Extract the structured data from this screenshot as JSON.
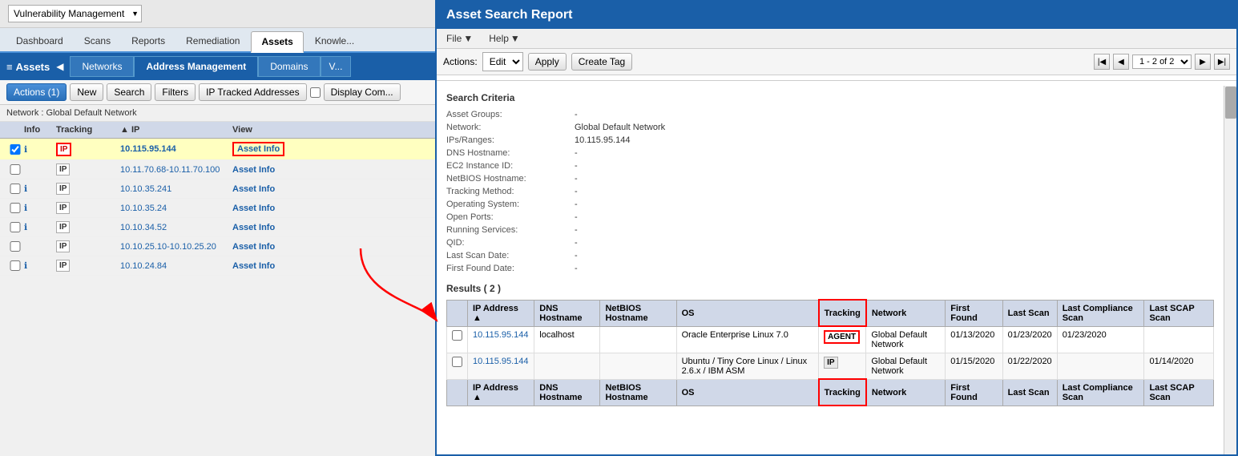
{
  "leftPanel": {
    "moduleSelect": "Vulnerability Management",
    "navTabs": [
      {
        "label": "Dashboard",
        "active": false
      },
      {
        "label": "Scans",
        "active": false
      },
      {
        "label": "Reports",
        "active": false
      },
      {
        "label": "Remediation",
        "active": false
      },
      {
        "label": "Assets",
        "active": true
      },
      {
        "label": "Knowle...",
        "active": false
      }
    ],
    "assetsTitle": "Assets",
    "subTabs": [
      {
        "label": "Networks",
        "active": false
      },
      {
        "label": "Address Management",
        "active": true
      },
      {
        "label": "Domains",
        "active": false
      },
      {
        "label": "V...",
        "active": false
      }
    ],
    "toolbar": {
      "actionsLabel": "Actions (1)",
      "newLabel": "New",
      "searchLabel": "Search",
      "filtersLabel": "Filters",
      "ipTrackedLabel": "IP Tracked Addresses",
      "displayCompLabel": "Display Com..."
    },
    "networkBar": "Network : Global Default Network",
    "tableColumns": [
      "",
      "Info",
      "Tracking",
      "IP",
      "View"
    ],
    "tableRows": [
      {
        "checked": true,
        "info": "i",
        "tracking": "IP",
        "ip": "10.115.95.144",
        "view": "Asset Info",
        "selected": true,
        "trackingHighlighted": true,
        "viewHighlighted": true
      },
      {
        "checked": false,
        "info": "",
        "tracking": "IP",
        "ip": "10.11.70.68-10.11.70.100",
        "view": "Asset Info",
        "selected": false
      },
      {
        "checked": false,
        "info": "i",
        "tracking": "IP",
        "ip": "10.10.35.241",
        "view": "Asset Info",
        "selected": false
      },
      {
        "checked": false,
        "info": "i",
        "tracking": "IP",
        "ip": "10.10.35.24",
        "view": "Asset Info",
        "selected": false
      },
      {
        "checked": false,
        "info": "i",
        "tracking": "IP",
        "ip": "10.10.34.52",
        "view": "Asset Info",
        "selected": false
      },
      {
        "checked": false,
        "info": "",
        "tracking": "IP",
        "ip": "10.10.25.10-10.10.25.20",
        "view": "Asset Info",
        "selected": false
      },
      {
        "checked": false,
        "info": "i",
        "tracking": "IP",
        "ip": "10.10.24.84",
        "view": "Asset Info",
        "selected": false
      }
    ]
  },
  "rightPanel": {
    "title": "Asset Search Report",
    "menu": {
      "file": "File",
      "help": "Help"
    },
    "toolbar": {
      "actionsLabel": "Actions:",
      "actionsValue": "Edit",
      "applyLabel": "Apply",
      "createTagLabel": "Create Tag"
    },
    "pagination": {
      "pageInfo": "1 - 2 of 2"
    },
    "searchCriteria": {
      "title": "Search Criteria",
      "rows": [
        {
          "label": "Asset Groups:",
          "value": "-"
        },
        {
          "label": "Network:",
          "value": "Global Default Network"
        },
        {
          "label": "IPs/Ranges:",
          "value": "10.115.95.144"
        },
        {
          "label": "DNS Hostname:",
          "value": "-"
        },
        {
          "label": "EC2 Instance ID:",
          "value": "-"
        },
        {
          "label": "NetBIOS Hostname:",
          "value": "-"
        },
        {
          "label": "Tracking Method:",
          "value": "-"
        },
        {
          "label": "Operating System:",
          "value": "-"
        },
        {
          "label": "Open Ports:",
          "value": "-"
        },
        {
          "label": "Running Services:",
          "value": "-"
        },
        {
          "label": "QID:",
          "value": "-"
        },
        {
          "label": "Last Scan Date:",
          "value": "-"
        },
        {
          "label": "First Found Date:",
          "value": "-"
        }
      ]
    },
    "results": {
      "title": "Results ( 2 )",
      "columns": [
        "",
        "IP Address",
        "DNS Hostname",
        "NetBIOS Hostname",
        "OS",
        "Tracking",
        "Network",
        "First Found",
        "Last Scan",
        "Last Compliance Scan",
        "Last SCAP Scan"
      ],
      "rows": [
        {
          "checked": false,
          "ip": "10.115.95.144",
          "dns": "localhost",
          "netbios": "",
          "os": "Oracle Enterprise Linux 7.0",
          "tracking": "AGENT",
          "trackingHighlighted": true,
          "network": "Global Default Network",
          "firstFound": "01/13/2020",
          "lastScan": "01/23/2020",
          "lastComplianceScan": "01/23/2020",
          "lastScapScan": ""
        },
        {
          "checked": false,
          "ip": "10.115.95.144",
          "dns": "",
          "netbios": "",
          "os": "Ubuntu / Tiny Core Linux / Linux 2.6.x / IBM ASM",
          "tracking": "IP",
          "trackingHighlighted": false,
          "network": "Global Default Network",
          "firstFound": "01/15/2020",
          "lastScan": "01/22/2020",
          "lastComplianceScan": "",
          "lastScapScan": "01/14/2020"
        }
      ],
      "footerColumns": [
        "",
        "IP Address",
        "DNS Hostname",
        "NetBIOS Hostname",
        "OS",
        "Tracking",
        "Network",
        "First Found",
        "Last Scan",
        "Last Compliance Scan",
        "Last SCAP Scan"
      ]
    }
  }
}
